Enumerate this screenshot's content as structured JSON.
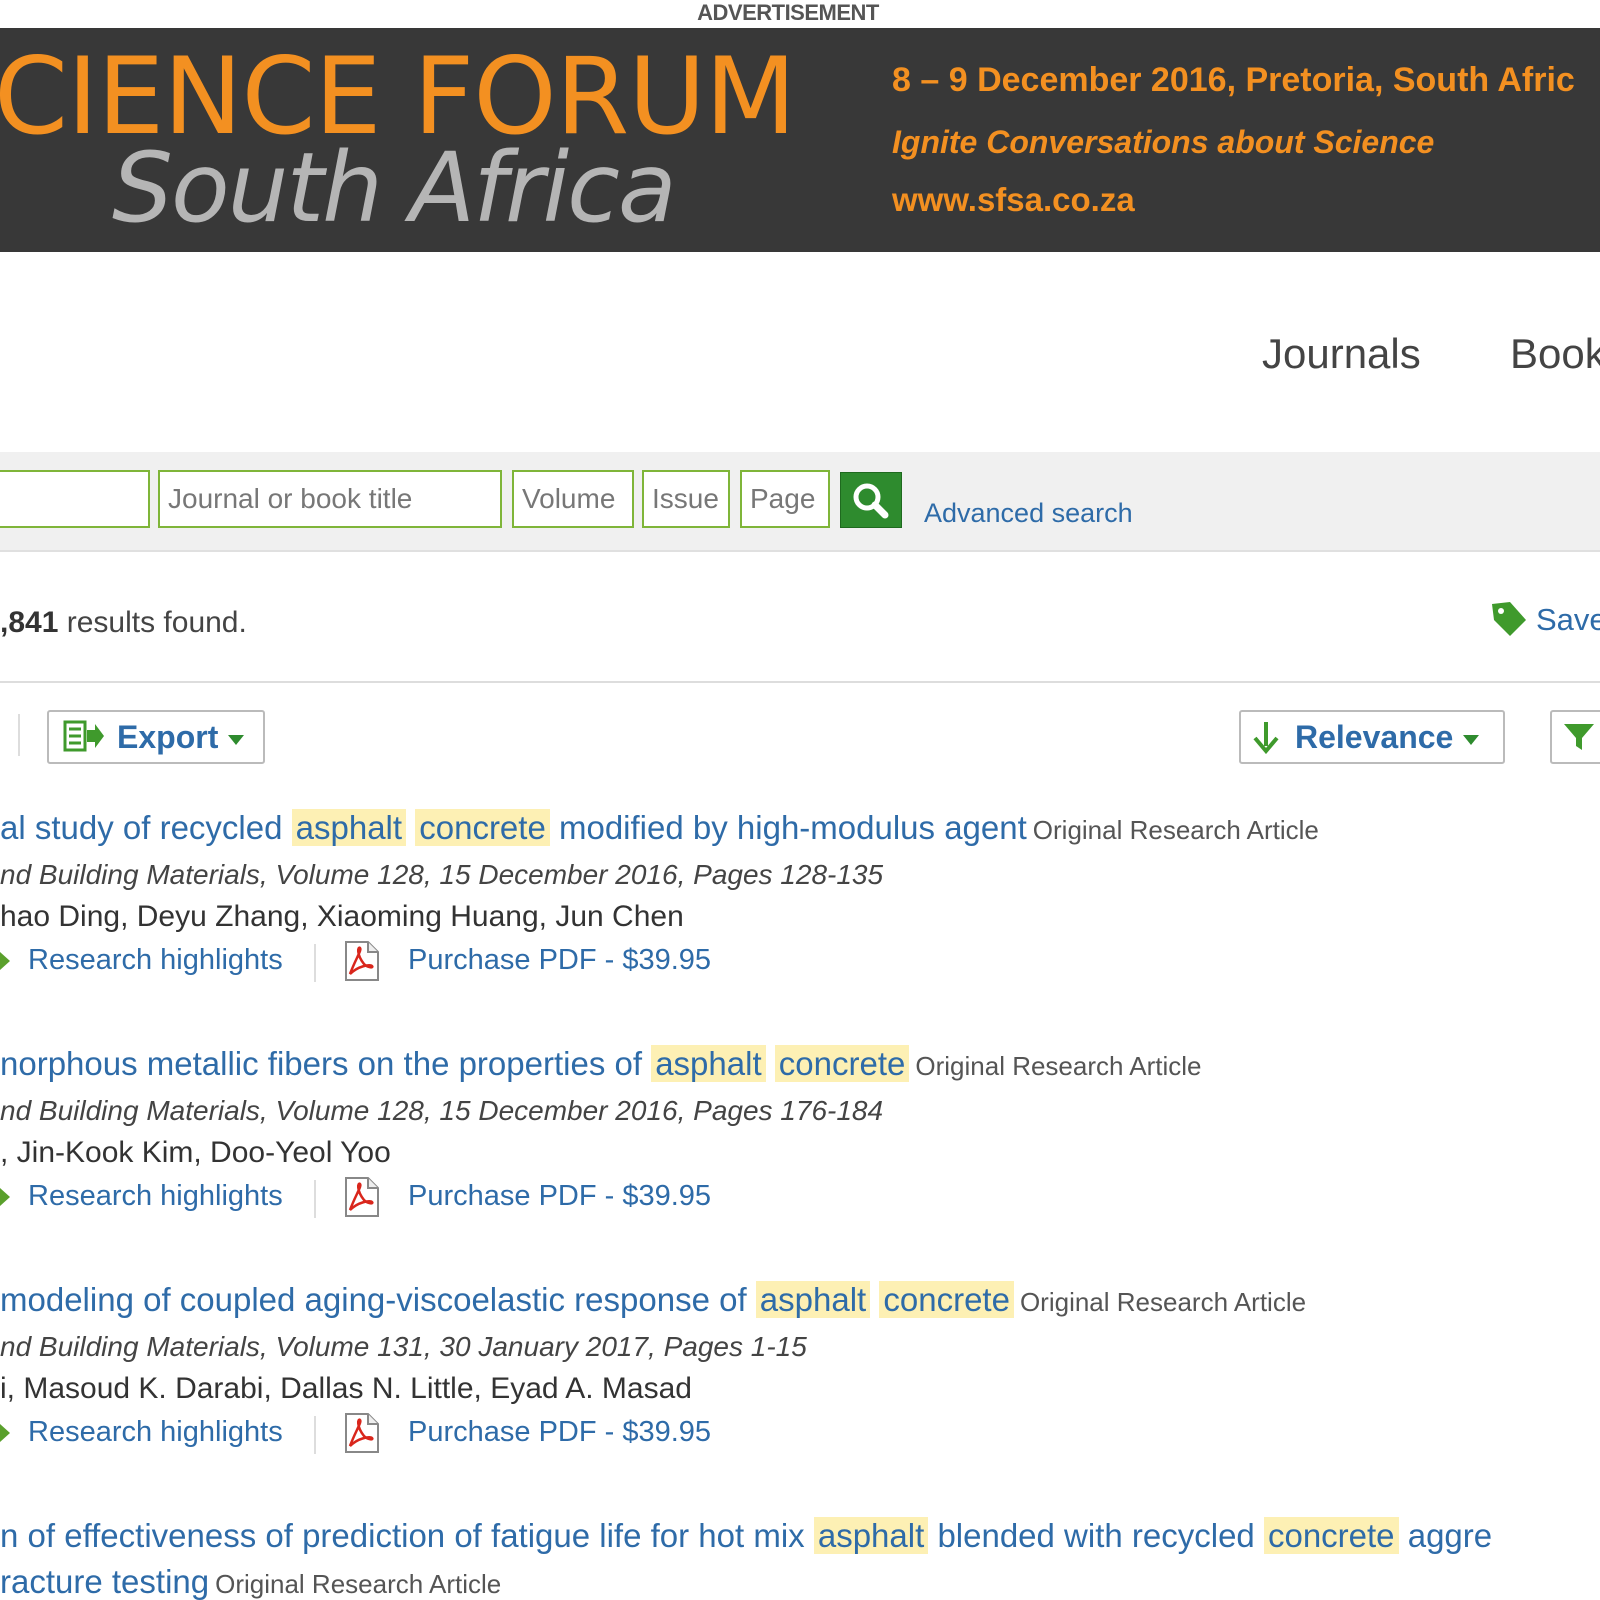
{
  "ad": {
    "label": "ADVERTISEMENT",
    "title": "CIENCE FORUM",
    "subtitle": "South Africa",
    "date": "8 – 9 December 2016, Pretoria, South Afric",
    "tagline": "Ignite Conversations about Science",
    "url": "www.sfsa.co.za",
    "colors": {
      "background": "#383838",
      "accent": "#f39021",
      "subtitle": "#b5b5b5"
    }
  },
  "nav": {
    "items": [
      {
        "label": "Journals"
      },
      {
        "label": "Book"
      }
    ]
  },
  "search": {
    "journal_placeholder": "Journal or book title",
    "volume_placeholder": "Volume",
    "issue_placeholder": "Issue",
    "page_placeholder": "Page",
    "advanced_label": "Advanced search"
  },
  "results": {
    "count": ",841",
    "count_suffix": " results found.",
    "save_label": "Save"
  },
  "toolbar": {
    "export_label": "Export",
    "sort_label": "Relevance"
  },
  "items": [
    {
      "title_a": "al study of recycled",
      "hl1": "asphalt",
      "hl2": "concrete",
      "title_b": "modified by high-modulus agent",
      "type": "Original Research Article",
      "source": "nd Building Materials, Volume 128, 15 December 2016, Pages 128-135",
      "authors": "hao Ding, Deyu Zhang, Xiaoming Huang, Jun Chen",
      "highlights": "Research highlights",
      "pdf": "Purchase PDF - $39.95"
    },
    {
      "title_a": "norphous metallic fibers on the properties of",
      "hl1": "asphalt",
      "hl2": "concrete",
      "title_b": "",
      "type": "Original Research Article",
      "source": "nd Building Materials, Volume 128, 15 December 2016, Pages 176-184",
      "authors": ", Jin-Kook Kim, Doo-Yeol Yoo",
      "highlights": "Research highlights",
      "pdf": "Purchase PDF - $39.95"
    },
    {
      "title_a": "modeling of coupled aging-viscoelastic response of",
      "hl1": "asphalt",
      "hl2": "concrete",
      "title_b": "",
      "type": "Original Research Article",
      "source": "nd Building Materials, Volume 131, 30 January 2017, Pages 1-15",
      "authors": "i, Masoud K. Darabi, Dallas N. Little, Eyad A. Masad",
      "highlights": "Research highlights",
      "pdf": "Purchase PDF - $39.95"
    },
    {
      "title_a": "n of effectiveness of prediction of fatigue life for hot mix",
      "hl1": "asphalt",
      "mid": "blended with recycled",
      "hl2": "concrete",
      "title_b": "aggre",
      "line2": "racture testing",
      "type": "Original Research Article"
    }
  ]
}
